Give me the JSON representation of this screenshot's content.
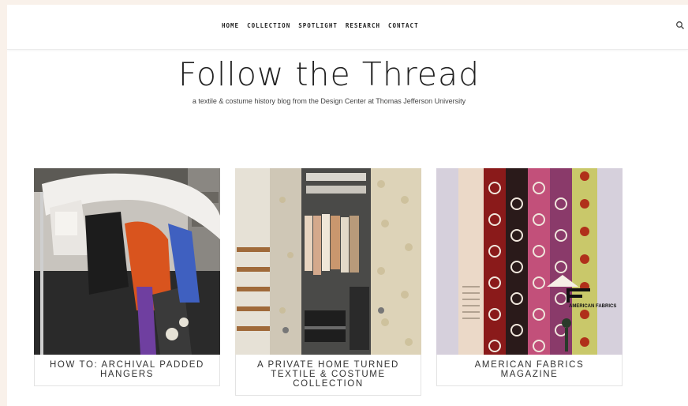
{
  "nav": {
    "items": [
      "HOME",
      "COLLECTION",
      "SPOTLIGHT",
      "RESEARCH",
      "CONTACT"
    ]
  },
  "site": {
    "title": "Follow the Thread",
    "tagline": "a textile & costume history blog from the Design Center at Thomas Jefferson University"
  },
  "posts": [
    {
      "title": "HOW TO: ARCHIVAL PADDED HANGERS"
    },
    {
      "title": "A PRIVATE HOME TURNED TEXTILE & COSTUME COLLECTION"
    },
    {
      "title": "AMERICAN FABRICS MAGAZINE"
    }
  ],
  "magazine_cover": {
    "logo_letters": "AF",
    "masthead": "AMERICAN FABRICS"
  },
  "colors": {
    "background": "#f9f1ea",
    "page": "#ffffff",
    "text": "#222222"
  },
  "icons": {
    "search": "search-icon"
  }
}
